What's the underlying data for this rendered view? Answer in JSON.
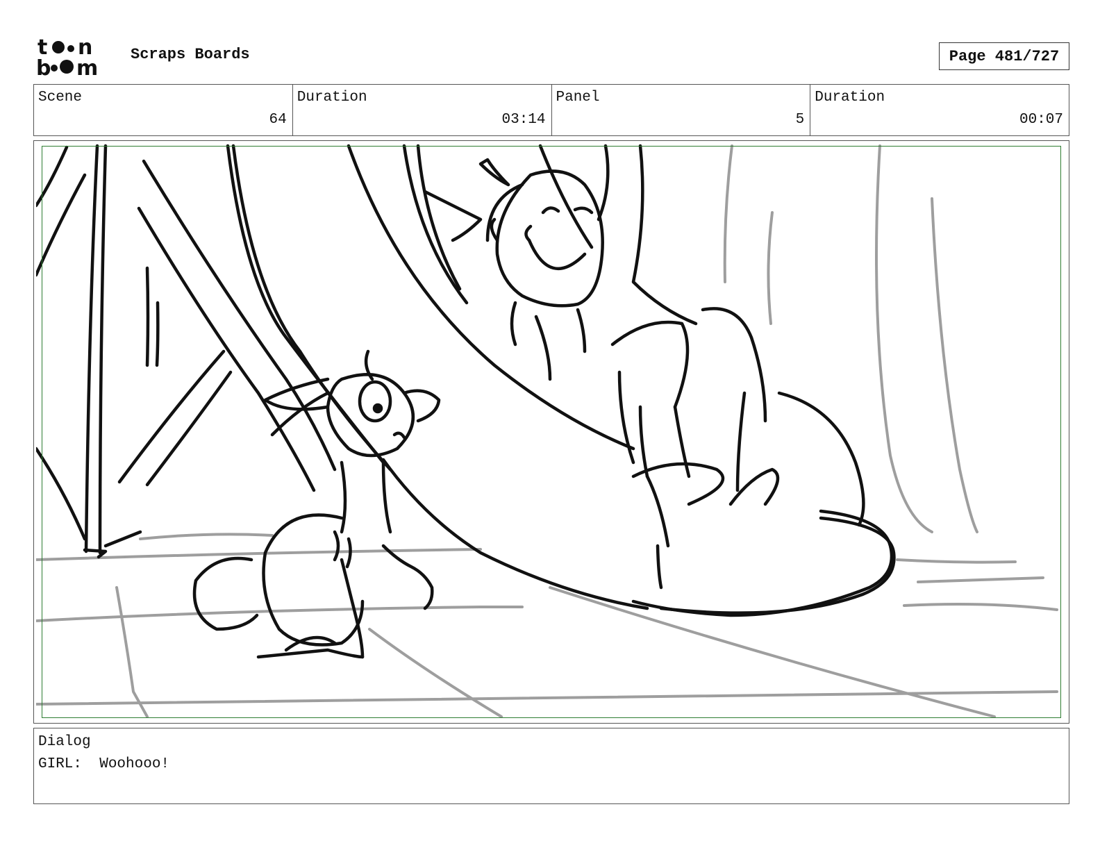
{
  "header": {
    "logo_text": "toon boom",
    "title": "Scraps Boards",
    "page_label": "Page 481/727"
  },
  "info": {
    "scene_label": "Scene",
    "scene_value": "64",
    "scene_duration_label": "Duration",
    "scene_duration_value": "03:14",
    "panel_label": "Panel",
    "panel_value": "5",
    "panel_duration_label": "Duration",
    "panel_duration_value": "00:07"
  },
  "dialog": {
    "label": "Dialog",
    "text": "GIRL:  Woohooo!"
  },
  "colors": {
    "safe_frame": "#2e7d32",
    "sketch_line": "#111111",
    "background_line": "#9e9e9e"
  }
}
